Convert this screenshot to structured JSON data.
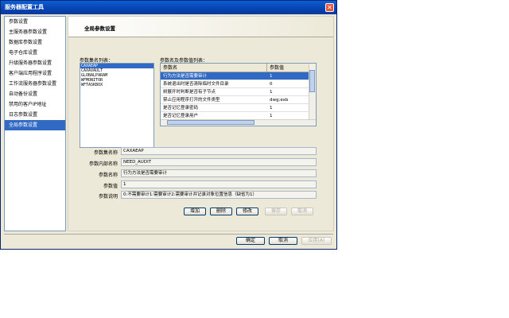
{
  "window": {
    "title": "服务器配置工具",
    "close_glyph": "✕"
  },
  "sidebar": {
    "items": [
      {
        "label": "参数设置"
      },
      {
        "label": "主服务器参数设置"
      },
      {
        "label": "数据库参数设置"
      },
      {
        "label": "电子仓库设置"
      },
      {
        "label": "升级服务器参数设置"
      },
      {
        "label": "客户端应用程序设置"
      },
      {
        "label": "工作流服务器参数设置"
      },
      {
        "label": "自动备份设置"
      },
      {
        "label": "禁用的客户IP地址"
      },
      {
        "label": "日志参数设置"
      },
      {
        "label": "全局参数设置"
      }
    ],
    "selected_index": 10
  },
  "content": {
    "title": "全局参数设置",
    "set_list_label": "参数集名列表：",
    "set_list": [
      "CAXAEAP",
      "CAXAVAULT",
      "GLOBALPARAM",
      "WFMONITOR",
      "WFTASKBOX"
    ],
    "set_selected_index": 0,
    "grid_label": "参数名及参数值列表：",
    "grid_headers": [
      "参数名",
      "参数值"
    ],
    "grid_rows": [
      {
        "name": "行为方法是否需要审计",
        "value": "1"
      },
      {
        "name": "系统退出时是否清除临时文件目录",
        "value": "0"
      },
      {
        "name": "树展开时判断是否有子节点",
        "value": "1"
      },
      {
        "name": "禁止应用程序打开的文件类型",
        "value": "dwg;exb"
      },
      {
        "name": "是否记忆登录密码",
        "value": "1"
      },
      {
        "name": "是否记忆登录用户",
        "value": "1"
      }
    ],
    "grid_selected_index": 0,
    "fields": {
      "set_name_label": "参数集名称",
      "set_name_value": "CAXAEAP",
      "internal_name_label": "参数内部名称",
      "internal_name_value": "NEED_AUDIT",
      "param_name_label": "参数名称",
      "param_name_value": "行为方法是否需要审计",
      "param_value_label": "参数值",
      "param_value_value": "1",
      "description_label": "参数说明",
      "description_value": "0:不需要审计1:需要审计2:需要审计并记录对象位置信息（缺省为1）"
    },
    "buttons": {
      "add": "增加",
      "delete": "删除",
      "modify": "修改",
      "save": "保存",
      "cancel": "取消"
    }
  },
  "footer": {
    "ok": "确定",
    "cancel": "取消",
    "apply": "应用(A)"
  }
}
